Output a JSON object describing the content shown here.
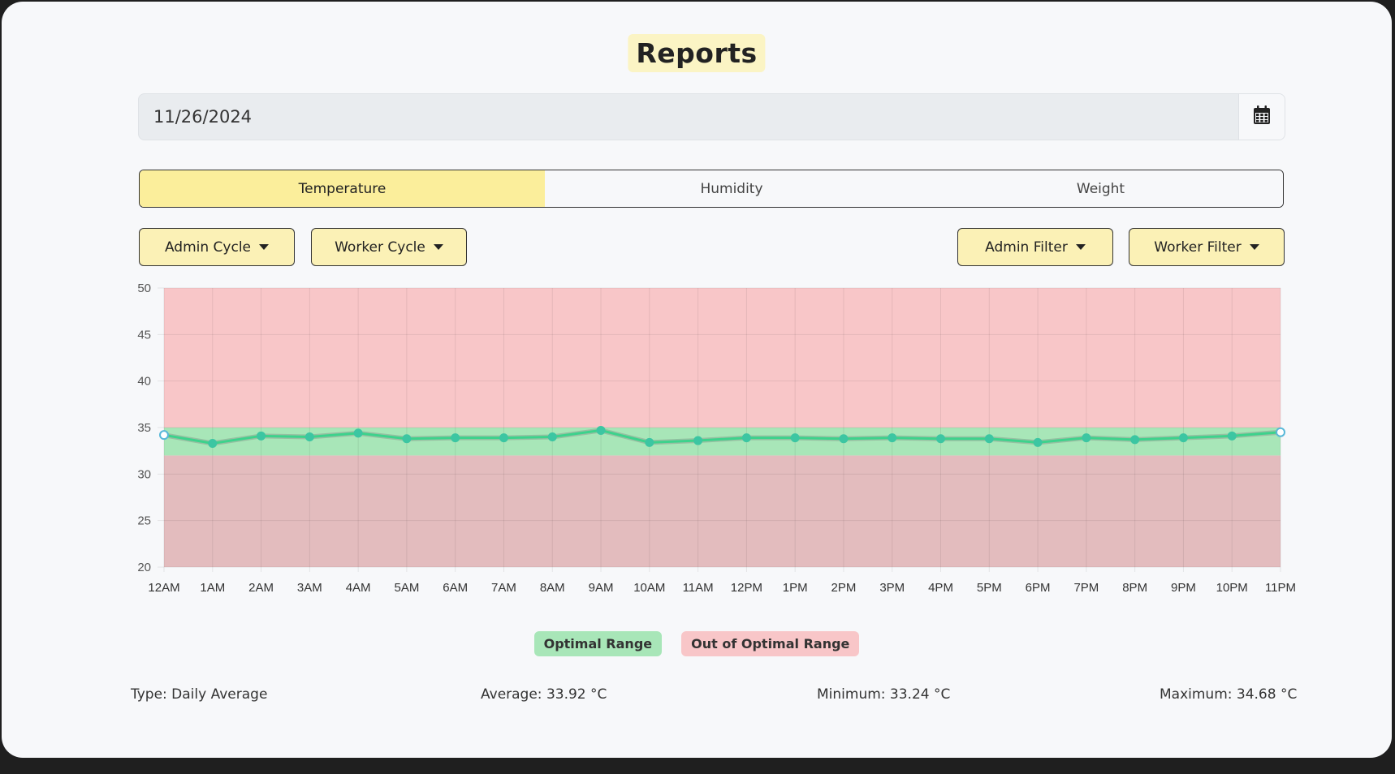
{
  "page": {
    "title": "Reports"
  },
  "date_picker": {
    "value": "11/26/2024",
    "icon": "calendar-icon"
  },
  "tabs": [
    {
      "label": "Temperature",
      "active": true
    },
    {
      "label": "Humidity",
      "active": false
    },
    {
      "label": "Weight",
      "active": false
    }
  ],
  "dropdowns": {
    "admin_cycle": "Admin Cycle",
    "worker_cycle": "Worker Cycle",
    "admin_filter": "Admin Filter",
    "worker_filter": "Worker Filter"
  },
  "legend": {
    "optimal": "Optimal Range",
    "out_of_optimal": "Out of Optimal Range"
  },
  "stats": {
    "type": "Type: Daily Average",
    "average": "Average: 33.92 °C",
    "minimum": "Minimum: 33.24 °C",
    "maximum": "Maximum: 34.68 °C"
  },
  "colors": {
    "active_tab": "#fbee9b",
    "button": "#fbf1b6",
    "optimal": "#a8e6b8",
    "out_of_optimal": "#f8c6c8",
    "line": "#3dd28c"
  },
  "chart_data": {
    "type": "line",
    "categories": [
      "12AM",
      "1AM",
      "2AM",
      "3AM",
      "4AM",
      "5AM",
      "6AM",
      "7AM",
      "8AM",
      "9AM",
      "10AM",
      "11AM",
      "12PM",
      "1PM",
      "2PM",
      "3PM",
      "4PM",
      "5PM",
      "6PM",
      "7PM",
      "8PM",
      "9PM",
      "10PM",
      "11PM"
    ],
    "values": [
      34.2,
      33.3,
      34.1,
      34.0,
      34.4,
      33.8,
      33.9,
      33.9,
      34.0,
      34.7,
      33.4,
      33.6,
      33.9,
      33.9,
      33.8,
      33.9,
      33.8,
      33.8,
      33.4,
      33.9,
      33.7,
      33.9,
      34.1,
      34.5
    ],
    "ylim": [
      20,
      50
    ],
    "yticks": [
      20,
      25,
      30,
      35,
      40,
      45,
      50
    ],
    "optimal_range": [
      32,
      35
    ],
    "grid": true
  }
}
